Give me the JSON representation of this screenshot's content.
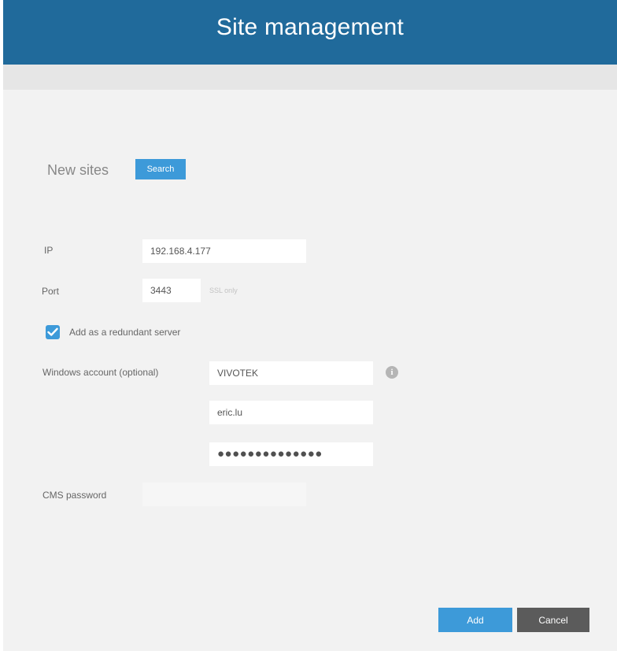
{
  "header": {
    "title": "Site management"
  },
  "new_sites": {
    "title": "New sites",
    "search_label": "Search"
  },
  "form": {
    "ip": {
      "label": "IP",
      "value": "192.168.4.177"
    },
    "port": {
      "label": "Port",
      "value": "3443",
      "hint": "SSL only"
    },
    "redundant": {
      "label": "Add as a redundant server",
      "checked": true
    },
    "windows_account": {
      "label": "Windows account (optional)",
      "domain_value": "VIVOTEK",
      "username_value": "eric.lu",
      "password_masked": "●●●●●●●●●●●●●●"
    },
    "cms_password": {
      "label": "CMS password",
      "value": ""
    }
  },
  "footer": {
    "add_label": "Add",
    "cancel_label": "Cancel"
  },
  "colors": {
    "header_bg": "#206a9b",
    "accent": "#3d9ad9",
    "cancel_bg": "#5b5b5b",
    "panel_bg": "#f2f2f2"
  }
}
